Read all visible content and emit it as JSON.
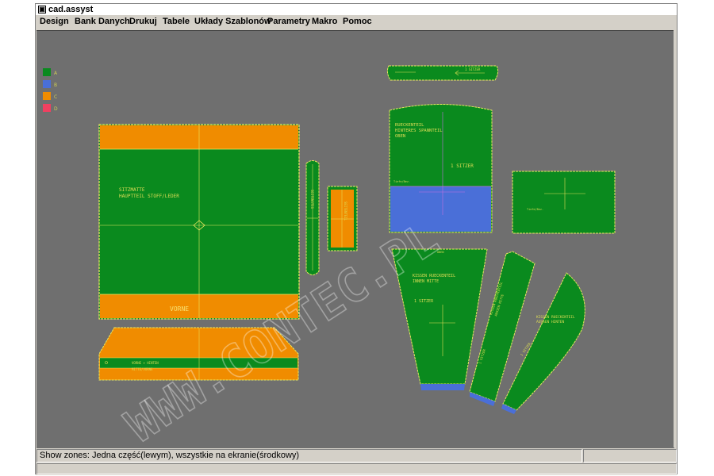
{
  "window": {
    "title": "cad.assyst",
    "app_icon": "window-icon"
  },
  "menu": {
    "items": [
      "Design",
      "Bank Danych",
      "Drukuj",
      "Tabele",
      "Układy Szablonów",
      "Parametry",
      "Makro",
      "Pomoc"
    ]
  },
  "legend": [
    {
      "label": "A",
      "color": "#0a8a1e"
    },
    {
      "label": "B",
      "color": "#4a6fd8"
    },
    {
      "label": "C",
      "color": "#f08c00"
    },
    {
      "label": "D",
      "color": "#f04060"
    }
  ],
  "colors": {
    "canvas": "#6f6f6f",
    "zone_a": "#0a8a1e",
    "zone_b": "#4a6fd8",
    "zone_c": "#f08c00",
    "outline": "#e8e860",
    "annotation": "#dddd55"
  },
  "pieces": {
    "seat_main": {
      "line1": "SITZMATTE",
      "line2": "HAUPTTEIL STOFF/LEDER",
      "bottom": "VORNE"
    },
    "narrow_strip": {
      "label": "SEITENSTEG"
    },
    "small_panel": {
      "label": "SEITENTEIL"
    },
    "front_panel": {
      "line1": "VORNE + HINTEN",
      "line2": "MITTE/VORNE"
    },
    "top_strip": {
      "label": "1 SITZER"
    },
    "back_panel": {
      "line1": "RUECKENTEIL",
      "line2": "HINTERES SPANNTEIL",
      "line3": "OBEN",
      "sitzer": "1 SITZER",
      "note": "Tiefe/Bez."
    },
    "side_panel": {
      "label": "Tiefe/Bez."
    },
    "cushion": {
      "line1": "KISSEN RUECKENTEIL",
      "line2": "INNEN MITTE",
      "sitzer": "1 SITZER",
      "top": "OBEN"
    },
    "cushion_strip": {
      "line1": "KISSEN RUECKENTEIL",
      "line2": "AUSSEN MITTE",
      "sitzer": "1 SITZER"
    },
    "cushion_side": {
      "line1": "KISSEN RUECKENTEIL",
      "line2": "AUSSEN HINTEN",
      "sitzer": "1 SITZER"
    }
  },
  "watermark": "WWW.CONTEC.PL",
  "status": {
    "text": "Show zones: Jedna część(lewym), wszystkie na ekranie(środkowy)"
  }
}
